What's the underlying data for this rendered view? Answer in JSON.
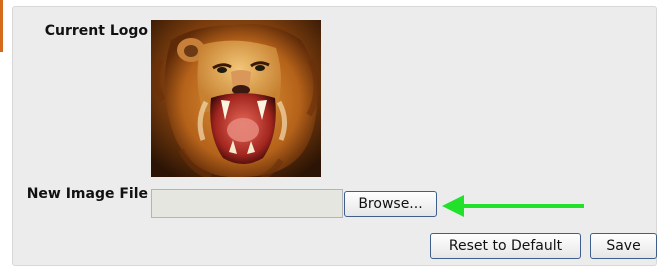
{
  "form": {
    "current_logo_label": "Current Logo",
    "new_image_label": "New Image File",
    "file_input_value": "",
    "browse_label": "Browse...",
    "reset_label": "Reset to Default",
    "save_label": "Save"
  },
  "logo_image": {
    "subject": "roaring lion"
  },
  "annotation": {
    "arrow_color": "#22e12a",
    "points_to": "browse-button"
  },
  "colors": {
    "panel_bg": "#ececec",
    "button_border": "#3e5f8e"
  }
}
